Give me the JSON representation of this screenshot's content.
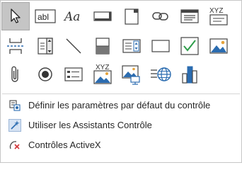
{
  "controls_gallery": {
    "rows": [
      [
        {
          "name": "select-pointer-icon",
          "tooltip_text": ""
        },
        {
          "name": "textbox-icon",
          "text": "abl"
        },
        {
          "name": "label-icon",
          "text": "Aa"
        },
        {
          "name": "button-icon"
        },
        {
          "name": "tab-control-icon"
        },
        {
          "name": "hyperlink-icon"
        },
        {
          "name": "web-browser-icon"
        },
        {
          "name": "navigation-control-icon",
          "text": "XYZ"
        }
      ],
      [
        {
          "name": "page-break-icon"
        },
        {
          "name": "combo-box-icon"
        },
        {
          "name": "line-icon"
        },
        {
          "name": "toggle-button-icon"
        },
        {
          "name": "list-box-icon"
        },
        {
          "name": "rectangle-icon"
        },
        {
          "name": "check-box-icon"
        },
        {
          "name": "image-icon"
        }
      ],
      [
        {
          "name": "attachment-icon"
        },
        {
          "name": "option-button-icon"
        },
        {
          "name": "subform-icon"
        },
        {
          "name": "unbound-object-frame-icon",
          "text": "XYZ"
        },
        {
          "name": "bound-object-frame-icon"
        },
        {
          "name": "insert-web-control-icon"
        },
        {
          "name": "chart-icon"
        }
      ]
    ]
  },
  "menu": {
    "items": [
      {
        "name": "set-control-defaults",
        "label": "Définir les paramètres par défaut du contrôle",
        "icon": "control-defaults-icon"
      },
      {
        "name": "use-control-wizards",
        "label": "Utiliser les Assistants Contrôle",
        "icon": "control-wizards-icon"
      },
      {
        "name": "activex-controls",
        "label": "Contrôles ActiveX",
        "icon": "activex-icon"
      }
    ]
  },
  "colors": {
    "accent_blue": "#2b6cb0",
    "green_check": "#2e9e4a",
    "selected_bg": "#c5c5c5",
    "icon_dark": "#444444"
  }
}
